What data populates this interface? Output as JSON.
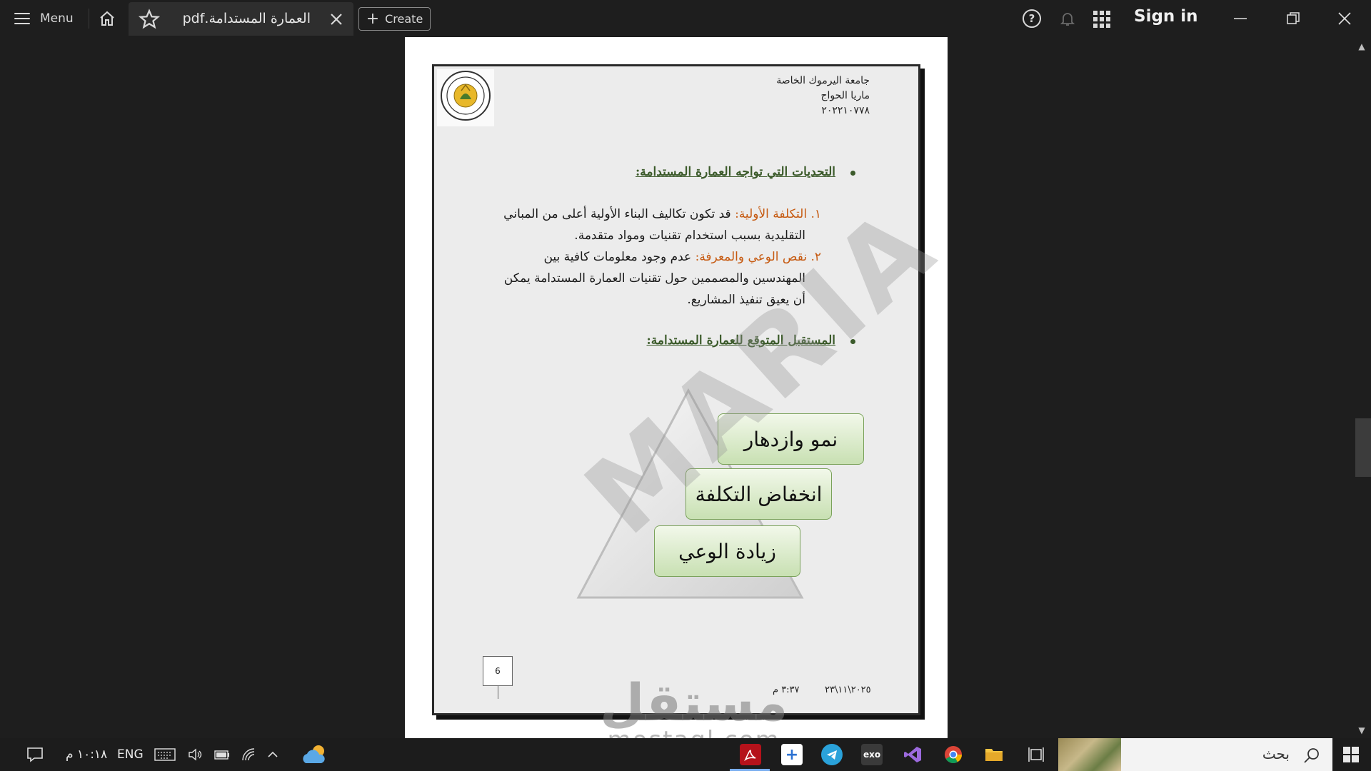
{
  "topbar": {
    "menu_label": "Menu",
    "tab_title": "العمارة المستدامة.pdf",
    "create_label": "Create",
    "help_label": "?",
    "sign_in_label": "Sign in"
  },
  "document": {
    "header_lines": [
      "جامعة اليرموك الخاصة",
      "ماريا الحواج",
      "٢٠٢٢١٠٧٧٨"
    ],
    "section1_title": "التحديات التي تواجه العمارة المستدامة:",
    "item1_num": "١.",
    "item1_key": "التكلفة الأولية:",
    "item1_text": "قد تكون تكاليف البناء الأولية أعلى من المباني",
    "item1_text2": "التقليدية بسبب استخدام تقنيات ومواد متقدمة.",
    "item2_num": "٢.",
    "item2_key": "نقص الوعي والمعرفة:",
    "item2_text": "عدم وجود معلومات كافية بين",
    "item2_text2": "المهندسين والمصممين حول تقنيات العمارة المستدامة يمكن",
    "item2_text3": "أن يعيق تنفيذ المشاريع.",
    "section2_title": "المستقبل المتوقع للعمارة المستدامة:",
    "pyramid_boxes": [
      "نمو وازدهار",
      "انخفاض التكلفة",
      "زيادة الوعي"
    ],
    "watermark": "MARIA",
    "page_number": "6",
    "footer_time": "٣:٣٧ م",
    "footer_date": "٢٠٢٥\\١١\\٢٣"
  },
  "overlay_watermark": {
    "arabic": "مستقل",
    "latin": "mostaql.com"
  },
  "taskbar": {
    "time": "١٠:١٨ م",
    "language": "ENG",
    "search_placeholder": "بحث",
    "apps": [
      "acrobat",
      "notes",
      "telegram",
      "exo",
      "visual-studio",
      "chrome",
      "file-explorer"
    ]
  },
  "colors": {
    "accent_green": "#3b5a2a",
    "accent_orange": "#c65a11",
    "box_border": "#7aa25a"
  }
}
